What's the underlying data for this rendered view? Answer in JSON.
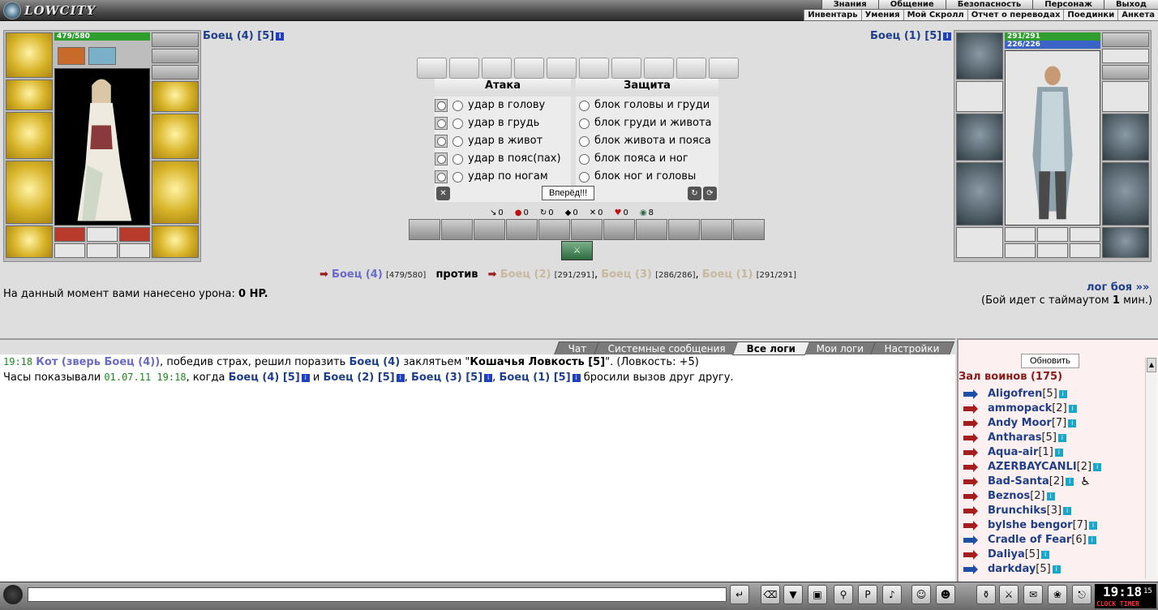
{
  "app": {
    "logo_text": "LOWCITY"
  },
  "topnav": {
    "main": [
      "Знания",
      "Общение",
      "Безопасность",
      "Персонаж",
      "Выход"
    ],
    "sub": [
      "Инвентарь",
      "Умения",
      "Мой Скролл",
      "Отчет о переводах",
      "Поединки",
      "Анкета"
    ]
  },
  "left_fighter": {
    "title": "Боец (4) [5]",
    "hp": "479/580"
  },
  "right_fighter": {
    "title": "Боец (1) [5]",
    "hp": "291/291",
    "mp": "226/226"
  },
  "attack": {
    "attack_header": "Атака",
    "defense_header": "Защита",
    "attacks": [
      "удар в голову",
      "удар в грудь",
      "удар в живот",
      "удар в пояс(пах)",
      "удар по ногам"
    ],
    "blocks": [
      "блок головы и груди",
      "блок груди и живота",
      "блок живота и пояса",
      "блок пояса и ног",
      "блок ног и головы"
    ],
    "go_button": "Вперёд!!!"
  },
  "stats": [
    "0",
    "0",
    "0",
    "0",
    "0",
    "0",
    "8"
  ],
  "versus": {
    "me_name": "Боец (4)",
    "me_hp": "[479/580]",
    "vs": "против",
    "enemies": [
      {
        "name": "Боец (2)",
        "hp": "[291/291]"
      },
      {
        "name": "Боец (3)",
        "hp": "[286/286]"
      },
      {
        "name": "Боец (1)",
        "hp": "[291/291]"
      }
    ]
  },
  "damage_line": {
    "prefix": "На данный момент вами нанесено урона:",
    "value": "0 HP."
  },
  "log_link": "лог боя »»",
  "timeout": {
    "prefix": "(Бой идет с таймаутом",
    "value": "1",
    "suffix": "мин.)"
  },
  "tabs": [
    "Чат",
    "Системные сообщения",
    "Все логи",
    "Мои логи",
    "Настройки"
  ],
  "log": {
    "line1": {
      "time": "19:18",
      "pet": "Кот (зверь Боец (4))",
      "text1": ", победив страх, решил поразить",
      "target": "Боец (4)",
      "text2": "заклятьем \"",
      "spell": "Кошачья Ловкость [5]",
      "text3": "\". (Ловкость: +5)"
    },
    "line2": {
      "text1": "Часы показывали",
      "date": "01.07.11 19:18",
      "text2": ", когда",
      "f1": "Боец (4) [5]",
      "and": "и",
      "f2": "Боец (2) [5]",
      "f3": "Боец (3) [5]",
      "f4": "Боец (1) [5]",
      "text3": "бросили вызов друг другу."
    }
  },
  "right_panel": {
    "refresh_button": "Обновить",
    "hall_title": "Зал воинов (175)",
    "players": [
      {
        "name": "Aligofren",
        "level": "[5]"
      },
      {
        "name": "ammopack",
        "level": "[2]"
      },
      {
        "name": "Andy Moor",
        "level": "[7]"
      },
      {
        "name": "Antharas",
        "level": "[5]"
      },
      {
        "name": "Aqua-air",
        "level": "[1]"
      },
      {
        "name": "AZERBAYCANLI",
        "level": "[2]"
      },
      {
        "name": "Bad-Santa",
        "level": "[2]"
      },
      {
        "name": "Beznos",
        "level": "[2]"
      },
      {
        "name": "Brunchiks",
        "level": "[3]"
      },
      {
        "name": "bylshe bengor",
        "level": "[7]"
      },
      {
        "name": "Cradle of Fear",
        "level": "[6]"
      },
      {
        "name": "Daliya",
        "level": "[5]"
      },
      {
        "name": "darkday",
        "level": "[5]"
      }
    ]
  },
  "clock": {
    "time": "19:18",
    "seconds": "15",
    "label": "CLOCK TIMER"
  }
}
